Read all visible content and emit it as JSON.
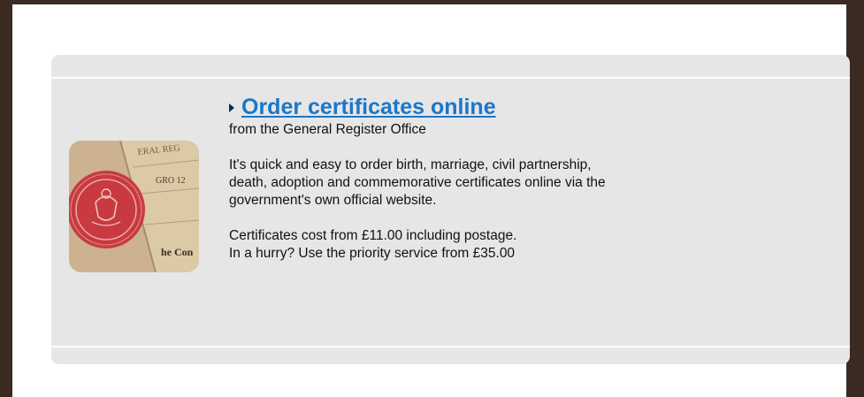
{
  "promo": {
    "title": "Order certificates online",
    "subtitle": "from the General Register Office",
    "description_lines": [
      "It's quick and easy to order birth, marriage, civil partnership,",
      "death, adoption and commemorative certificates online via the",
      "government's own official website."
    ],
    "pricing_lines": [
      "Certificates cost from £11.00 including postage.",
      "In a hurry? Use the priority service from £35.00"
    ],
    "image_text": {
      "header": "ERAL REG",
      "ref": "GRO 12",
      "footer": "he Con"
    }
  },
  "colors": {
    "frame": "#3a2a22",
    "panel": "#e6e6e6",
    "link": "#1a77c9",
    "arrow": "#0a2a66",
    "seal": "#c8303a"
  }
}
